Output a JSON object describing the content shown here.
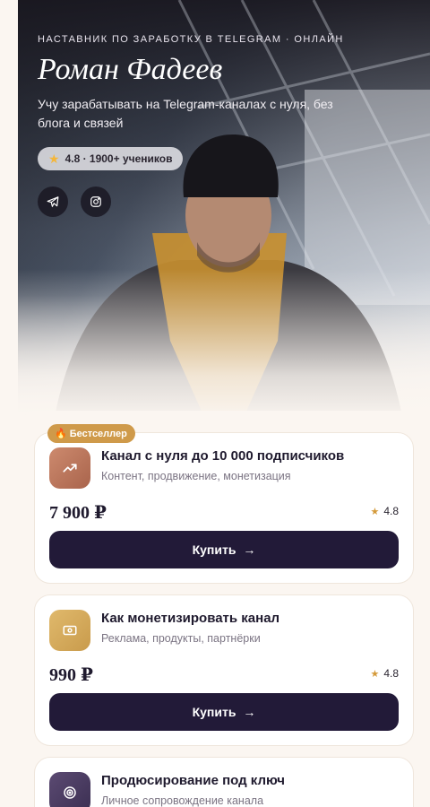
{
  "hero": {
    "eyebrow": "НАСТАВНИК ПО ЗАРАБОТКУ В TELEGRAM · ОНЛАЙН",
    "name": "Роман Фадеев",
    "subtitle": "Учу зарабатывать на Telegram-каналах с нуля, без блога и связей",
    "rating_text": "4.8 · 1900+ учеников",
    "socials": [
      {
        "icon": "telegram-icon"
      },
      {
        "icon": "instagram-icon"
      }
    ]
  },
  "products": [
    {
      "badge": "Бестселлер",
      "icon": "trending-up-icon",
      "title": "Канал с нуля до 10 000 подписчиков",
      "description": "Контент, продвижение, монетизация",
      "price": "7 900 ₽",
      "rating": "4.8",
      "button_label": "Купить"
    },
    {
      "icon": "money-icon",
      "title": "Как монетизировать канал",
      "description": "Реклама, продукты, партнёрки",
      "price": "990 ₽",
      "rating": "4.8",
      "button_label": "Купить"
    },
    {
      "icon": "target-icon",
      "title": "Продюсирование под ключ",
      "description": "Личное сопровождение канала"
    }
  ],
  "colors": {
    "background": "#fbf6f1",
    "button": "#221a38",
    "badge": "#cf9a4a",
    "star": "#d49a3a"
  }
}
